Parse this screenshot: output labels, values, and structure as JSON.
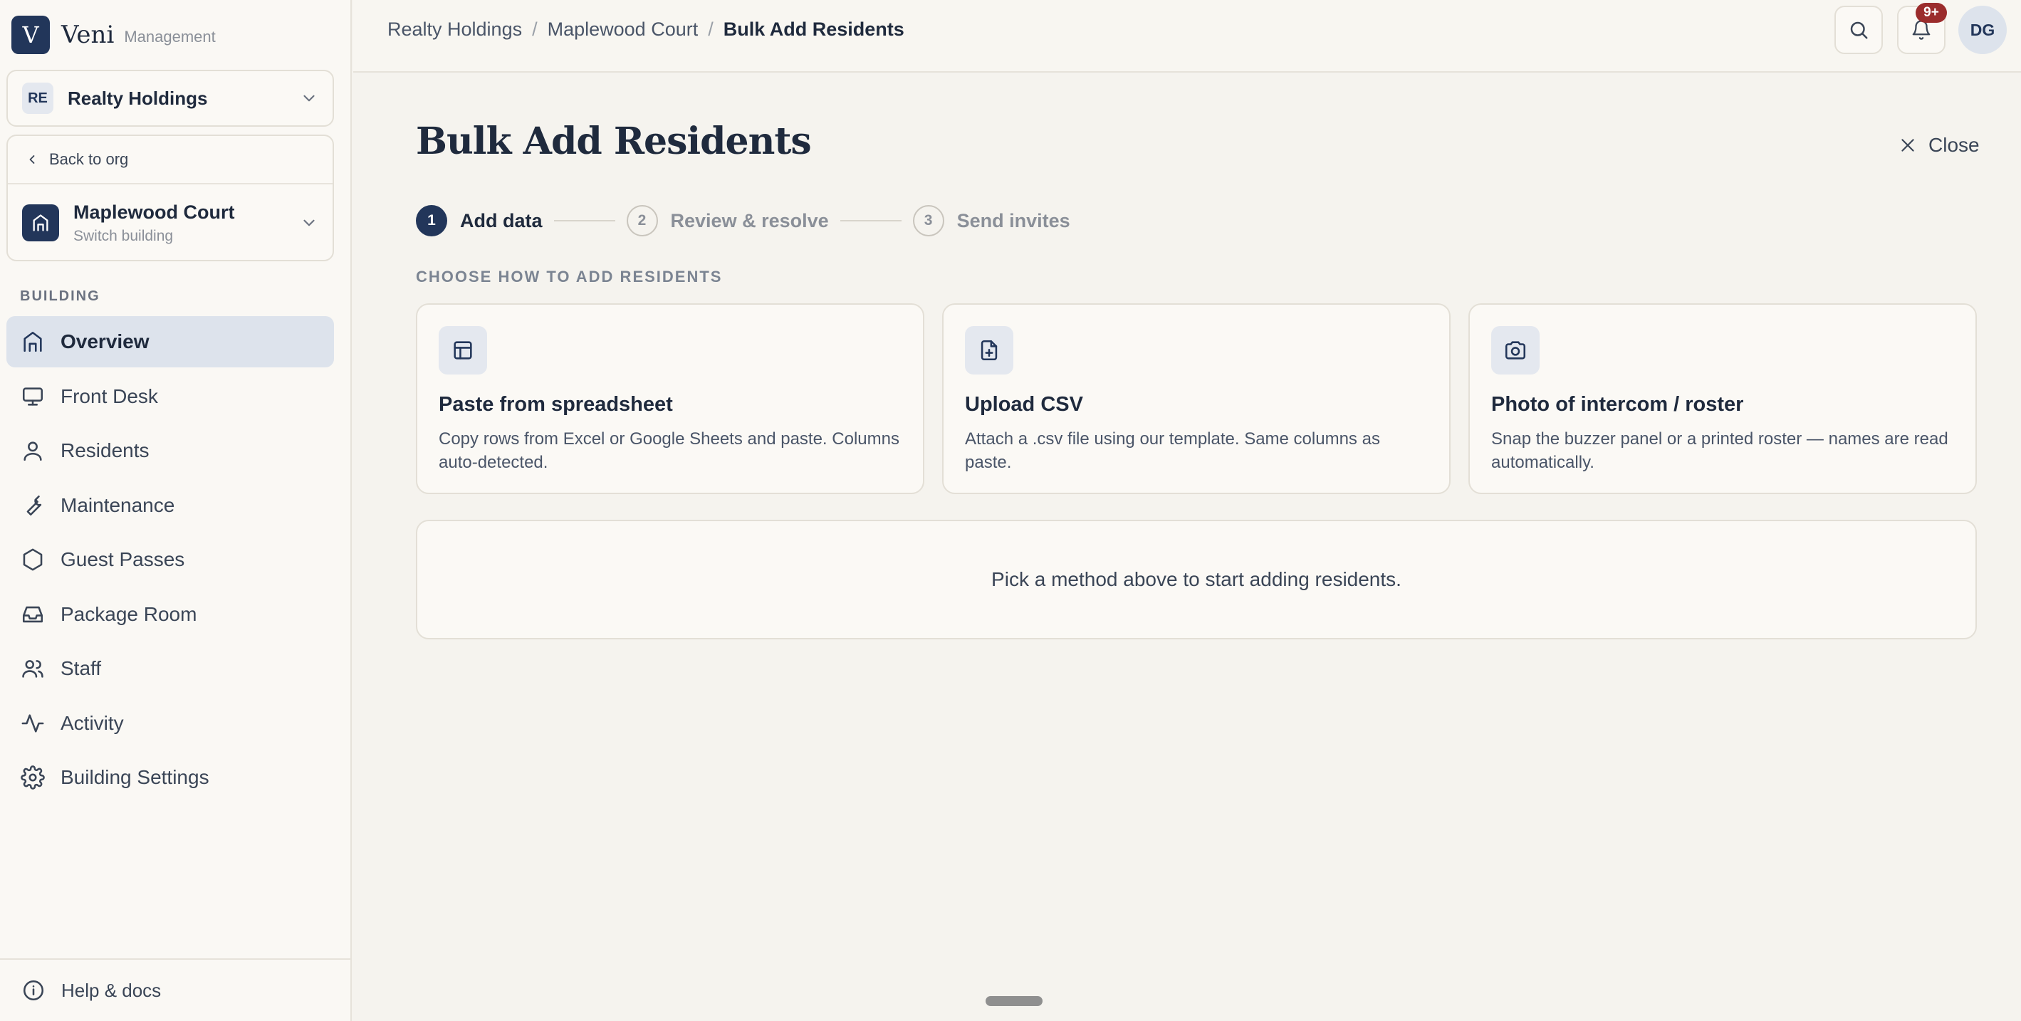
{
  "brand": {
    "logo_letter": "V",
    "name": "Veni",
    "subtitle": "Management"
  },
  "org": {
    "badge": "RE",
    "name": "Realty Holdings"
  },
  "building": {
    "back_label": "Back to org",
    "name": "Maplewood Court",
    "switch_label": "Switch building"
  },
  "sidebar": {
    "section_label": "BUILDING",
    "items": [
      {
        "label": "Overview",
        "icon": "home-icon",
        "active": true
      },
      {
        "label": "Front Desk",
        "icon": "monitor-icon"
      },
      {
        "label": "Residents",
        "icon": "user-icon"
      },
      {
        "label": "Maintenance",
        "icon": "wrench-icon"
      },
      {
        "label": "Guest Passes",
        "icon": "hexagon-icon"
      },
      {
        "label": "Package Room",
        "icon": "inbox-icon"
      },
      {
        "label": "Staff",
        "icon": "users-icon"
      },
      {
        "label": "Activity",
        "icon": "activity-icon"
      },
      {
        "label": "Building Settings",
        "icon": "gear-icon"
      }
    ],
    "help_label": "Help & docs"
  },
  "header": {
    "breadcrumbs": [
      "Realty Holdings",
      "Maplewood Court",
      "Bulk Add Residents"
    ],
    "notification_count": "9+",
    "avatar_initials": "DG"
  },
  "page": {
    "title": "Bulk Add Residents",
    "close_label": "Close",
    "steps": [
      {
        "num": "1",
        "label": "Add data",
        "active": true
      },
      {
        "num": "2",
        "label": "Review & resolve",
        "active": false
      },
      {
        "num": "3",
        "label": "Send invites",
        "active": false
      }
    ],
    "choose_label": "CHOOSE HOW TO ADD RESIDENTS",
    "methods": [
      {
        "title": "Paste from spreadsheet",
        "desc": "Copy rows from Excel or Google Sheets and paste. Columns auto-detected.",
        "icon": "table-icon"
      },
      {
        "title": "Upload CSV",
        "desc": "Attach a .csv file using our template. Same columns as paste.",
        "icon": "file-plus-icon"
      },
      {
        "title": "Photo of intercom / roster",
        "desc": "Snap the buzzer panel or a printed roster — names are read automatically.",
        "icon": "camera-icon"
      }
    ],
    "empty_message": "Pick a method above to start adding residents."
  },
  "colors": {
    "accent": "#22365a",
    "badge": "#9b2c2c",
    "background": "#f5f3ee"
  }
}
